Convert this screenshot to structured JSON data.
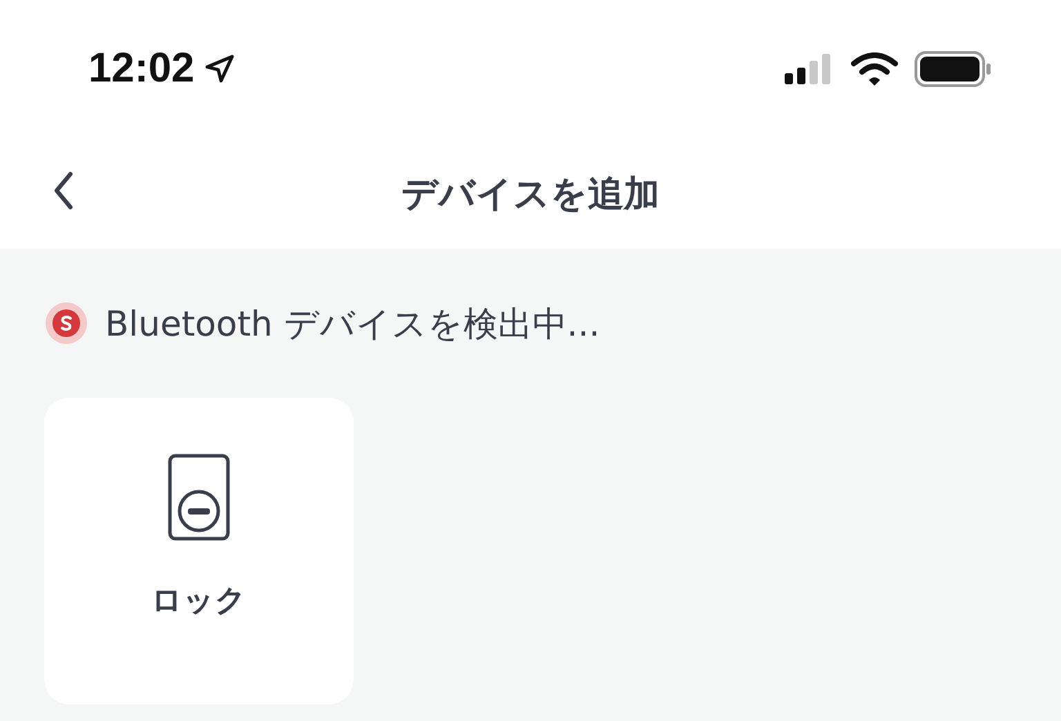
{
  "status_bar": {
    "time": "12:02"
  },
  "nav": {
    "title": "デバイスを追加"
  },
  "scan": {
    "text": "Bluetooth デバイスを検出中..."
  },
  "devices": [
    {
      "kind": "lock",
      "label": "ロック"
    }
  ]
}
